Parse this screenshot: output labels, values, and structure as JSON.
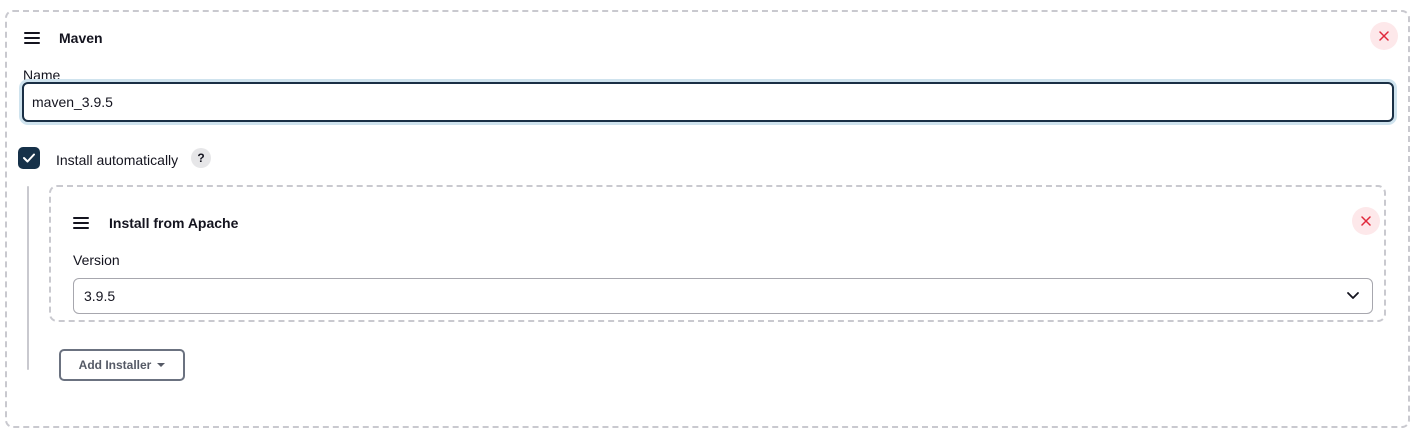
{
  "tool": {
    "title": "Maven",
    "name_label": "Name",
    "name_value": "maven_3.9.5",
    "install_automatically": {
      "label": "Install automatically",
      "checked": true,
      "help_glyph": "?"
    }
  },
  "installer": {
    "title": "Install from Apache",
    "version_label": "Version",
    "version_value": "3.9.5"
  },
  "add_installer_label": "Add Installer",
  "icons": {
    "drag": "drag-handle-icon",
    "close": "close-icon",
    "check": "checkmark-icon",
    "chevron": "chevron-down-icon",
    "caret": "caret-down-icon"
  },
  "colors": {
    "checkbox_bg": "#163149",
    "close_bg": "#fde8ea",
    "close_fg": "#e0283b",
    "focus_ring": "#cfe3ee",
    "border_dashed": "#c9c9cf"
  }
}
